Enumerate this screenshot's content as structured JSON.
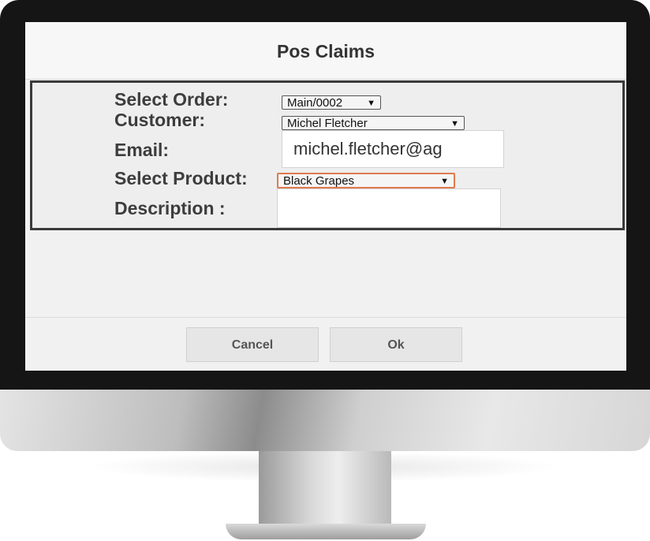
{
  "dialog": {
    "title": "Pos Claims"
  },
  "form": {
    "order": {
      "label": "Select Order:",
      "value": "Main/0002"
    },
    "customer": {
      "label": "Customer:",
      "value": "Michel Fletcher"
    },
    "email": {
      "label": "Email:",
      "value": "michel.fletcher@ag"
    },
    "product": {
      "label": "Select Product:",
      "value": "Black Grapes"
    },
    "description": {
      "label": "Description :",
      "value": ""
    }
  },
  "buttons": {
    "cancel": "Cancel",
    "ok": "Ok"
  },
  "icons": {
    "dropdown": "▼"
  }
}
